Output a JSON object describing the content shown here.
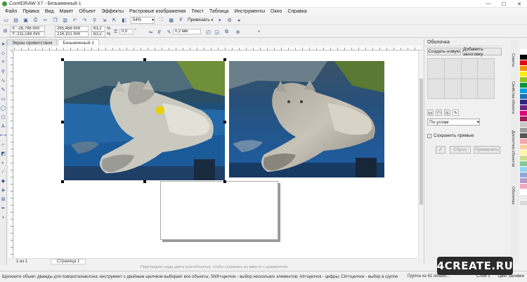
{
  "window": {
    "title": "CorelDRAW X7 - Безымянный-1",
    "min": "—",
    "max": "☐",
    "close": "✕"
  },
  "menu": [
    "Файл",
    "Правка",
    "Вид",
    "Макет",
    "Объект",
    "Эффекты",
    "Растровые изображения",
    "Текст",
    "Таблица",
    "Инструменты",
    "Окно",
    "Справка"
  ],
  "toolbar": {
    "zoom": "54%",
    "snap_label": "Привязать к"
  },
  "props": {
    "x": "X: -26,796 mm",
    "y": "Y: 211,144 mm",
    "w": "285,468 mm",
    "h": "214,101 mm",
    "sx": "63,2",
    "sy": "63,2",
    "pct": "%",
    "angle": "0,0",
    "angle_unit": "°",
    "outline": "0,2 мм"
  },
  "tabs": [
    {
      "label": "Экран приветствия"
    },
    {
      "label": "Безымянный-1"
    }
  ],
  "canvas": {
    "page_counter": "1 из 1",
    "page_tab": "Страница 1",
    "hint": "Перетащите сюда цвета (или объекты), чтобы сохранить их вместе с документом"
  },
  "docker": {
    "title": "Оболочка",
    "btn_create": "Создать новую",
    "btn_add_preset": "Добавить заготовку",
    "mapping_mode": "По углам",
    "keep_lines": "Сохранить прямые",
    "btn_apply": "Сброс",
    "btn_preview": "Применить"
  },
  "side_tabs": [
    "Советы",
    "Свойства объекта",
    "Диспетчер объектов",
    "Оболочка"
  ],
  "palette_colors": [
    "#ffffff",
    "#000000",
    "#e30613",
    "#f39200",
    "#ffed00",
    "#95c11f",
    "#00963f",
    "#009fe3",
    "#1d71b8",
    "#312783",
    "#662483",
    "#e6007e",
    "#a2195b",
    "#c7c7c7",
    "#9d9d9c",
    "#575756",
    "#f6a6a6",
    "#fbd0a0",
    "#fff7a5",
    "#c8dd8a",
    "#7fc99a",
    "#8ed3f2",
    "#8fa8d6",
    "#b39acb",
    "#f2a7c7",
    "#ffffff",
    "#ececec",
    "#d9d9d9"
  ],
  "status": {
    "message": "Щелкните объект дважды для поворота/наклона; инструмент с двойным щелчком выбирает все объекты; Shift+щелчок - выбор нескольких элементов; Alt+щелчок - цифры; Ctrl+щелчок - выбор в группе",
    "group": "Группа из 62 объект...",
    "layer": "Слой 1",
    "color_label": "Цвет заливки"
  },
  "watermark": "4CREATE.RU"
}
